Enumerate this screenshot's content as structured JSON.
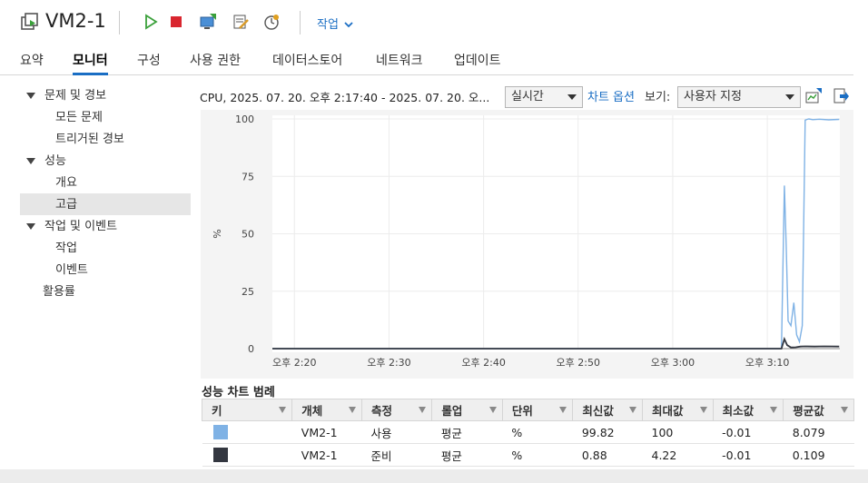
{
  "header": {
    "title": "VM2-1",
    "actions_label": "작업"
  },
  "tabs": [
    "요약",
    "모니터",
    "구성",
    "사용 권한",
    "데이터스토어",
    "네트워크",
    "업데이트"
  ],
  "nav": {
    "group1": "문제 및 경보",
    "all_issues": "모든 문제",
    "triggered_alarms": "트리거된 경보",
    "group2": "성능",
    "overview": "개요",
    "advanced": "고급",
    "group3": "작업 및 이벤트",
    "tasks": "작업",
    "events": "이벤트",
    "utilization": "활용률"
  },
  "toolbar": {
    "chart_title": "CPU, 2025. 07. 20. 오후 2:17:40 - 2025. 07. 20. 오...",
    "timespan": "실시간",
    "chart_options": "차트 옵션",
    "view_label": "보기:",
    "view_value": "사용자 지정"
  },
  "legend": {
    "title": "성능 차트 범례",
    "columns": [
      "키",
      "개체",
      "측정",
      "롤업",
      "단위",
      "최신값",
      "최대값",
      "최소값",
      "평균값"
    ],
    "rows": [
      {
        "color": "#7fb2e5",
        "object": "VM2-1",
        "measure": "사용",
        "rollup": "평균",
        "unit": "%",
        "latest": "99.82",
        "max": "100",
        "min": "-0.01",
        "avg": "8.079"
      },
      {
        "color": "#333740",
        "object": "VM2-1",
        "measure": "준비",
        "rollup": "평균",
        "unit": "%",
        "latest": "0.88",
        "max": "4.22",
        "min": "-0.01",
        "avg": "0.109"
      }
    ]
  },
  "chart_data": {
    "type": "line",
    "ylabel": "%",
    "ylim": [
      0,
      100
    ],
    "y_ticks": [
      "0",
      "25",
      "50",
      "75",
      "100"
    ],
    "x_ticks": [
      "오후 2:20",
      "오후 2:30",
      "오후 2:40",
      "오후 2:50",
      "오후 3:00",
      "오후 3:10"
    ],
    "x_tick_minutes": [
      20,
      30,
      40,
      50,
      60,
      70
    ],
    "xlim_minutes": [
      17.67,
      77.67
    ],
    "series": [
      {
        "name": "사용",
        "color": "#7fb2e5",
        "x": [
          17.67,
          71.5,
          71.8,
          72.0,
          72.2,
          72.5,
          72.8,
          73.1,
          73.4,
          73.7,
          74.0,
          74.2,
          74.4,
          74.8,
          75.5,
          76.5,
          77.6
        ],
        "y": [
          0,
          0,
          71,
          45,
          12,
          10,
          20,
          6,
          3,
          10,
          99.5,
          99.8,
          100,
          99.7,
          99.9,
          99.6,
          99.8
        ]
      },
      {
        "name": "준비",
        "color": "#333740",
        "x": [
          17.67,
          71.5,
          71.8,
          72.1,
          72.5,
          73.0,
          73.5,
          74.0,
          75.0,
          76.0,
          77.6
        ],
        "y": [
          0,
          0,
          4.2,
          1.5,
          0.5,
          0.6,
          0.9,
          1.0,
          0.9,
          1.0,
          0.9
        ]
      }
    ]
  }
}
